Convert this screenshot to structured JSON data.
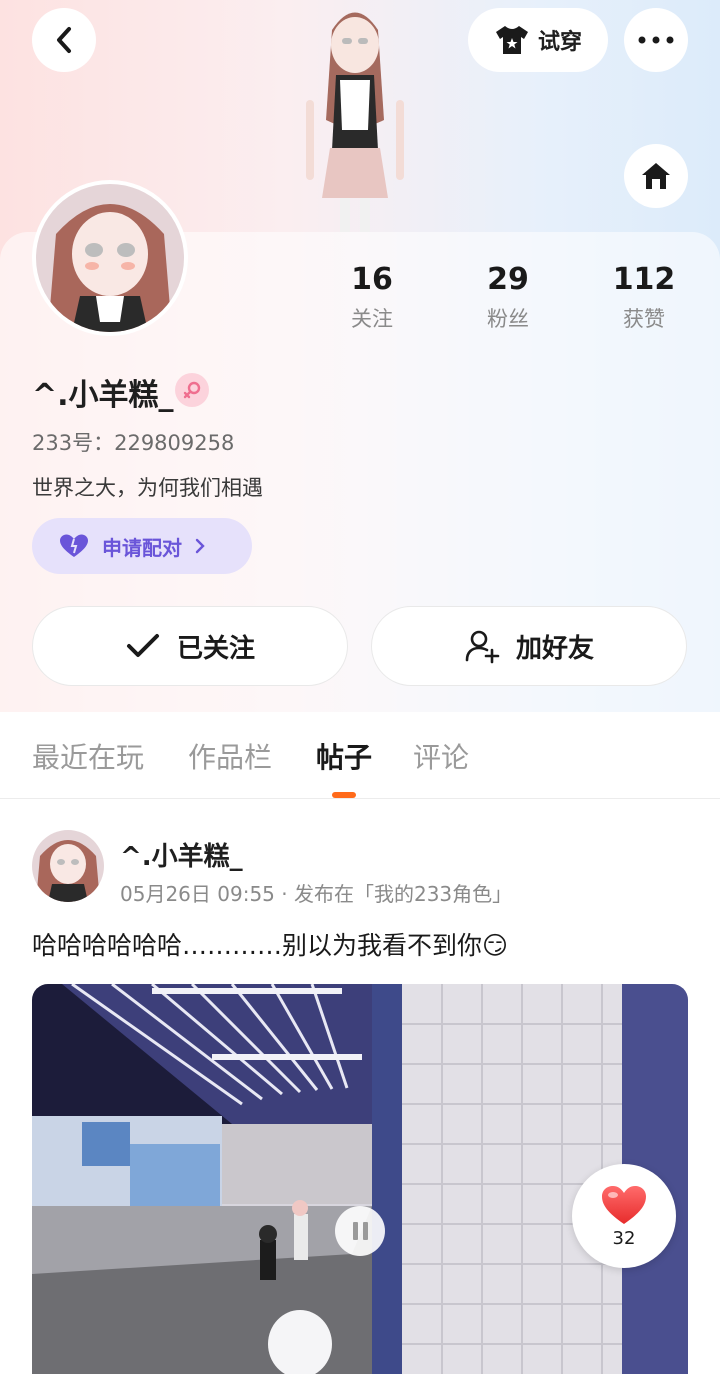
{
  "header": {
    "try_on_label": "试穿"
  },
  "profile": {
    "name": "^.小羊糕_",
    "uid_label": "233号：",
    "uid": "229809258",
    "bio": "世界之大，为何我们相遇",
    "match_label": "申请配对",
    "stats": [
      {
        "num": "16",
        "label": "关注"
      },
      {
        "num": "29",
        "label": "粉丝"
      },
      {
        "num": "112",
        "label": "获赞"
      }
    ],
    "follow_label": "已关注",
    "add_friend_label": "加好友"
  },
  "tabs": [
    {
      "label": "最近在玩"
    },
    {
      "label": "作品栏"
    },
    {
      "label": "帖子"
    },
    {
      "label": "评论"
    }
  ],
  "post": {
    "author": "^.小羊糕_",
    "meta": "05月26日 09:55 · 发布在「我的233角色」",
    "text": "哈哈哈哈哈哈…………别以为我看不到你😏",
    "like_count": "32"
  },
  "colors": {
    "accent_orange": "#ff6a1a",
    "match_purple": "#6a55d9",
    "heart_red": "#f03a3a"
  }
}
